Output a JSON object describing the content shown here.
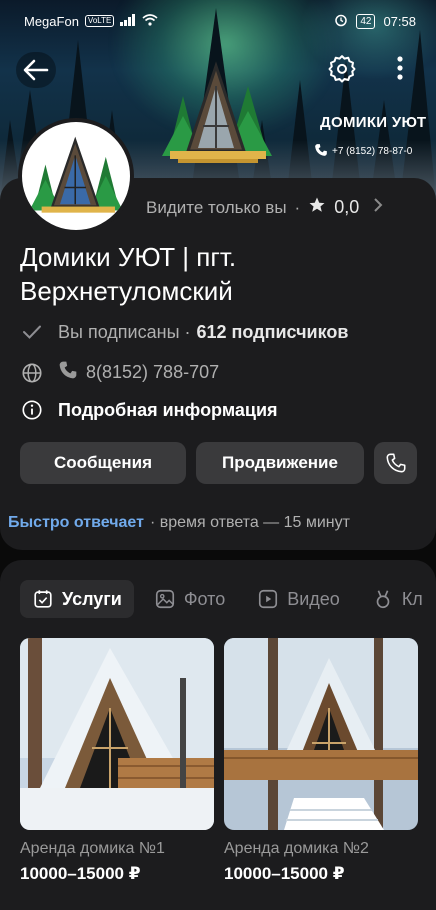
{
  "status_bar": {
    "carrier": "MegaFon",
    "volte": "VoLTE",
    "battery": "42",
    "time": "07:58"
  },
  "cover": {
    "title": "ДОМИКИ УЮТ",
    "phone": "+7 (8152) 78-87-0"
  },
  "profile": {
    "visibility": "Видите только вы",
    "rating": "0,0",
    "name": "Домики УЮТ | пгт. Верхнетуломский",
    "subscribed": "Вы подписаны ·",
    "subscribers": "612 подписчиков",
    "phone": "8(8152) 788-707",
    "more_info": "Подробная информация"
  },
  "buttons": {
    "messages": "Сообщения",
    "promotion": "Продвижение"
  },
  "response": {
    "fast": "Быстро отвечает",
    "time": "· время ответа — 15 минут"
  },
  "tabs": [
    {
      "label": "Услуги",
      "icon": "services-icon",
      "active": true
    },
    {
      "label": "Фото",
      "icon": "photo-icon",
      "active": false
    },
    {
      "label": "Видео",
      "icon": "video-icon",
      "active": false
    },
    {
      "label": "Кл",
      "icon": "clips-icon",
      "active": false
    }
  ],
  "products": [
    {
      "name": "Аренда домика №1",
      "price": "10000–15000 ₽"
    },
    {
      "name": "Аренда домика №2",
      "price": "10000–15000 ₽"
    }
  ],
  "colors": {
    "background": "#0a0a0a",
    "card": "#1c1c1e",
    "button": "#3a3a3c",
    "accent": "#71aaeb"
  }
}
